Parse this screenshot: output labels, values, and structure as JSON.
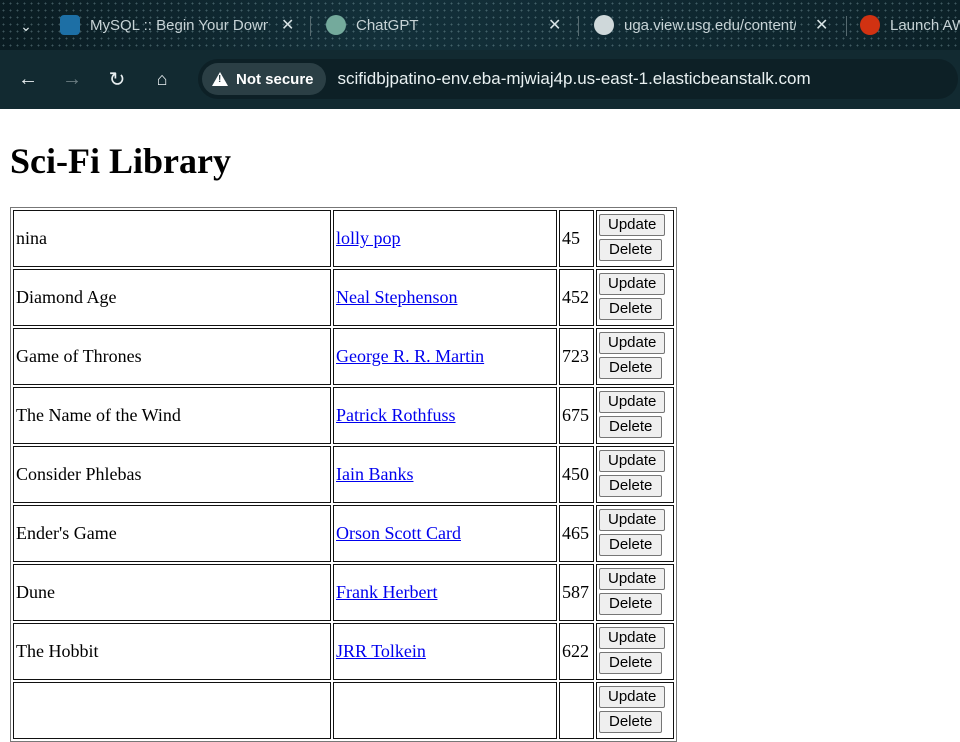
{
  "browser": {
    "tabs": [
      {
        "title": "MySQL :: Begin Your Down",
        "favicon": "mysql-icon",
        "color": "#1d6fa5"
      },
      {
        "title": "ChatGPT",
        "favicon": "chatgpt-icon",
        "color": "#74aa9c"
      },
      {
        "title": "uga.view.usg.edu/content/",
        "favicon": "globe-icon",
        "color": "#cfd8da"
      },
      {
        "title": "Launch AW",
        "favicon": "aws-icon",
        "color": "#d13212"
      }
    ],
    "security_label": "Not secure",
    "url": "scifidbjpatino-env.eba-mjwiaj4p.us-east-1.elasticbeanstalk.com"
  },
  "page": {
    "title": "Sci-Fi Library",
    "update_label": "Update",
    "delete_label": "Delete",
    "books": [
      {
        "title": "nina",
        "author": "lolly pop",
        "pages": "45"
      },
      {
        "title": "Diamond Age",
        "author": "Neal Stephenson",
        "pages": "452"
      },
      {
        "title": "Game of Thrones",
        "author": "George R. R. Martin",
        "pages": "723"
      },
      {
        "title": "The Name of the Wind",
        "author": "Patrick Rothfuss",
        "pages": "675"
      },
      {
        "title": "Consider Phlebas",
        "author": "Iain Banks",
        "pages": "450"
      },
      {
        "title": "Ender's Game",
        "author": "Orson Scott Card",
        "pages": "465"
      },
      {
        "title": "Dune",
        "author": "Frank Herbert",
        "pages": "587"
      },
      {
        "title": "The Hobbit",
        "author": "JRR Tolkein",
        "pages": "622"
      },
      {
        "title": "",
        "author": "",
        "pages": ""
      }
    ]
  }
}
